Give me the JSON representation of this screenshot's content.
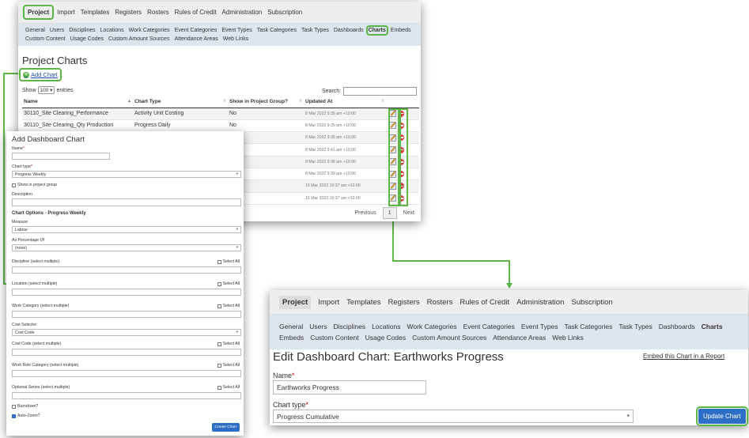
{
  "top": {
    "menu": [
      "Project",
      "Import",
      "Templates",
      "Registers",
      "Rosters",
      "Rules of Credit",
      "Administration",
      "Subscription"
    ],
    "submenu": [
      "General",
      "Users",
      "Disciplines",
      "Locations",
      "Work Categories",
      "Event Categories",
      "Event Types",
      "Task Categories",
      "Task Types",
      "Dashboards",
      "Charts",
      "Embeds",
      "Custom Content",
      "Usage Codes",
      "Custom Amount Sources",
      "Attendance Areas",
      "Web Links"
    ],
    "title": "Project Charts",
    "add_chart": "Add Chart",
    "show_label": "Show",
    "entries_value": "100",
    "entries_label": "entries",
    "search_label": "Search:",
    "columns": [
      "Name",
      "Chart Type",
      "Show in Project Group?",
      "Updated At"
    ],
    "rows": [
      {
        "name": "30110_Site Clearing_Performance",
        "type": "Activity Unit Costing",
        "group": "No",
        "updated": "8 Mar 2022 9:35 am +10:00"
      },
      {
        "name": "30110_Site Clearing_Qty Production",
        "type": "Progress Daily",
        "group": "No",
        "updated": "8 Mar 2022 9:35 am +10:00"
      },
      {
        "name": "",
        "type": "",
        "group": "",
        "updated": "8 Mar 2022 9:35 am +10:00"
      },
      {
        "name": "",
        "type": "",
        "group": "",
        "updated": "8 Mar 2022 9:41 am +10:00"
      },
      {
        "name": "",
        "type": "",
        "group": "",
        "updated": "8 Mar 2022 9:36 am +10:00"
      },
      {
        "name": "",
        "type": "",
        "group": "",
        "updated": "8 Mar 2022 9:39 am +10:00"
      },
      {
        "name": "",
        "type": "",
        "group": "",
        "updated": "15 Mar 2022 10:37 am +10:00"
      },
      {
        "name": "",
        "type": "",
        "group": "",
        "updated": "15 Mar 2022 10:37 am +10:00"
      }
    ],
    "pager": {
      "previous": "Previous",
      "page": "1",
      "next": "Next"
    }
  },
  "add": {
    "title": "Add Dashboard Chart",
    "name_label": "Name",
    "chart_type_label": "Chart type",
    "chart_type_value": "Progress Weekly",
    "show_group": "Show in project group",
    "description": "Description",
    "options_title": "Chart Options - Progress Weekly",
    "measure_label": "Measure",
    "measure_value": "Labour",
    "pct_label": "As Percentage Of",
    "pct_value": "(none)",
    "discipline": "Discipline (select multiple)",
    "location": "Location (select multiple)",
    "workcat": "Work Category (select multiple)",
    "cost_selector": "Cost Selector",
    "cost_selector_value": "Cost Code",
    "cost_code": "Cost Code (select multiple)",
    "work_role": "Work Role Category (select multiple)",
    "optional_series": "Optional Series (select multiple)",
    "select_all": "Select All",
    "burndown": "Burndown?",
    "autozoom": "Auto-Zoom?",
    "create": "Create Chart"
  },
  "edit": {
    "menu": [
      "Project",
      "Import",
      "Templates",
      "Registers",
      "Rosters",
      "Rules of Credit",
      "Administration",
      "Subscription"
    ],
    "submenu": [
      "General",
      "Users",
      "Disciplines",
      "Locations",
      "Work Categories",
      "Event Categories",
      "Event Types",
      "Task Categories",
      "Task Types",
      "Dashboards",
      "Charts",
      "Embeds",
      "Custom Content",
      "Usage Codes",
      "Custom Amount Sources",
      "Attendance Areas",
      "Web Links"
    ],
    "title": "Edit Dashboard Chart: Earthworks Progress",
    "embed_link": "Embed this Chart in a Report",
    "name_label": "Name",
    "name_value": "Earthworks Progress",
    "chart_type_label": "Chart type",
    "chart_type_value": "Progress Cumulative",
    "update": "Update Chart"
  }
}
